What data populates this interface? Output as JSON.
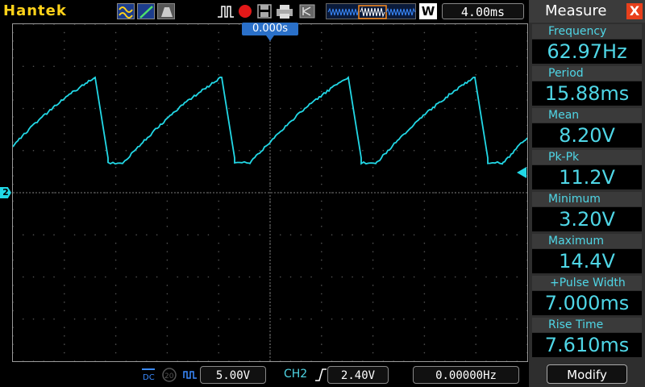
{
  "topbar": {
    "brand": "Hantek",
    "timebase": "4.00ms",
    "mode_button": "W"
  },
  "screen": {
    "trigger_position": "0.000s",
    "channel_marker": "2"
  },
  "measure_panel": {
    "title": "Measure",
    "close_label": "X",
    "items": [
      {
        "label": "Frequency",
        "value": "62.97Hz"
      },
      {
        "label": "Period",
        "value": "15.88ms"
      },
      {
        "label": "Mean",
        "value": "8.20V"
      },
      {
        "label": "Pk-Pk",
        "value": "11.2V"
      },
      {
        "label": "Minimum",
        "value": "3.20V"
      },
      {
        "label": "Maximum",
        "value": "14.4V"
      },
      {
        "label": "+Pulse Width",
        "value": "7.000ms"
      },
      {
        "label": "Rise Time",
        "value": "7.610ms"
      }
    ],
    "modify_label": "Modify"
  },
  "bottombar": {
    "coupling": "DC",
    "bw_limit": "20",
    "volts_div": "5.00V",
    "trigger_source": "CH2",
    "trigger_level": "2.40V",
    "trigger_freq": "0.00000Hz"
  },
  "colors": {
    "trace": "#22d8e6",
    "brand": "#ffd21a",
    "accent_blue": "#2a70c9",
    "close_red": "#e8401c"
  }
}
